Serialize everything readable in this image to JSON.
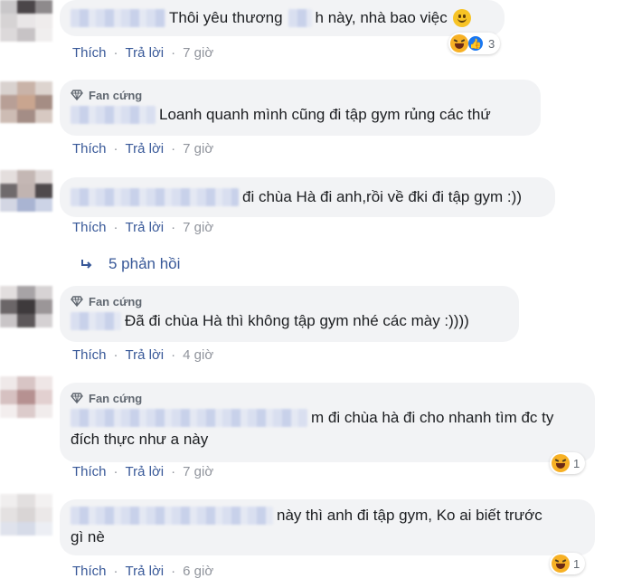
{
  "comments": [
    {
      "text": "Thôi yêu thương",
      "text_after": "h này, nhà bao việc",
      "actions": {
        "like": "Thích",
        "reply": "Trả lời",
        "time": "7 giờ"
      },
      "reaction_count": "3"
    },
    {
      "badge": "Fan cứng",
      "text": "Loanh quanh mình cũng đi tập gym rủng các thứ",
      "actions": {
        "like": "Thích",
        "reply": "Trả lời",
        "time": "7 giờ"
      }
    },
    {
      "text": "đi chùa Hà đi anh,rồi về đki đi tập gym :))",
      "actions": {
        "like": "Thích",
        "reply": "Trả lời",
        "time": "7 giờ"
      },
      "replies_label": "5 phản hồi"
    },
    {
      "badge": "Fan cứng",
      "text": "Đã đi chùa Hà thì không tập gym nhé các mày :))))",
      "actions": {
        "like": "Thích",
        "reply": "Trả lời",
        "time": "4 giờ"
      }
    },
    {
      "badge": "Fan cứng",
      "text_line1": "m đi chùa hà đi cho nhanh tìm đc ty",
      "text_line2": "đích thực như a này",
      "actions": {
        "like": "Thích",
        "reply": "Trả lời",
        "time": "7 giờ"
      },
      "reaction_count": "1"
    },
    {
      "text_line1": "này thì anh đi tập gym, Ko ai biết trước",
      "text_line2": "gì nè",
      "actions": {
        "like": "Thích",
        "reply": "Trả lời",
        "time": "6 giờ"
      },
      "reaction_count": "1"
    }
  ],
  "separator": "·",
  "colors": {
    "link": "#385898",
    "bubble": "#f2f3f5",
    "meta": "#90949c"
  }
}
